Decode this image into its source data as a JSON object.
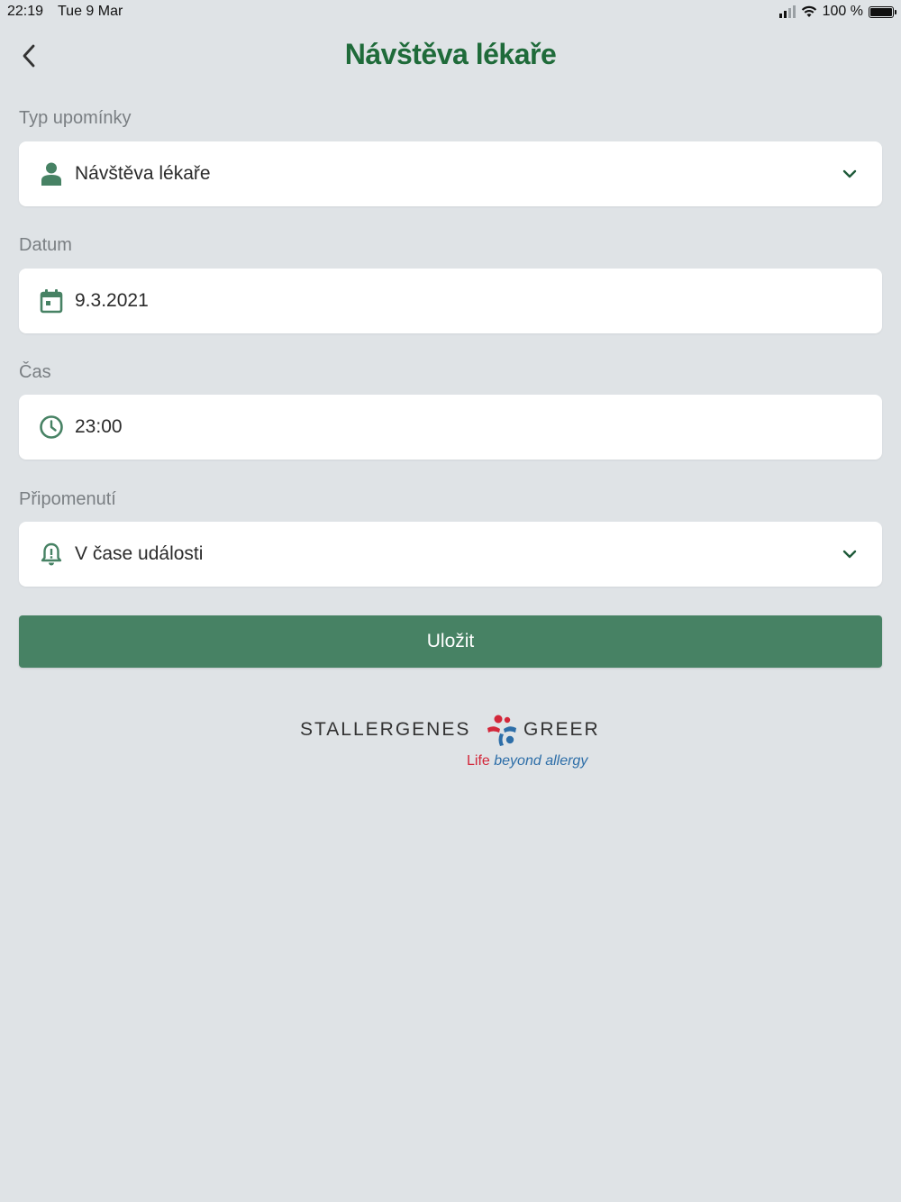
{
  "status_bar": {
    "time": "22:19",
    "date": "Tue 9 Mar",
    "battery": "100 %"
  },
  "header": {
    "title": "Návštěva lékaře"
  },
  "form": {
    "reminder_type": {
      "label": "Typ upomínky",
      "value": "Návštěva lékaře"
    },
    "date": {
      "label": "Datum",
      "value": "9.3.2021"
    },
    "time": {
      "label": "Čas",
      "value": "23:00"
    },
    "reminder": {
      "label": "Připomenutí",
      "value": "V čase události"
    }
  },
  "save_button": {
    "label": "Uložit"
  },
  "brand": {
    "name_left": "STALLERGENES",
    "name_right": "GREER",
    "tagline_part1": "Life",
    "tagline_part2": "beyond allergy"
  },
  "colors": {
    "accent": "#478264",
    "title": "#1f6b3a",
    "background": "#dfe3e6"
  }
}
